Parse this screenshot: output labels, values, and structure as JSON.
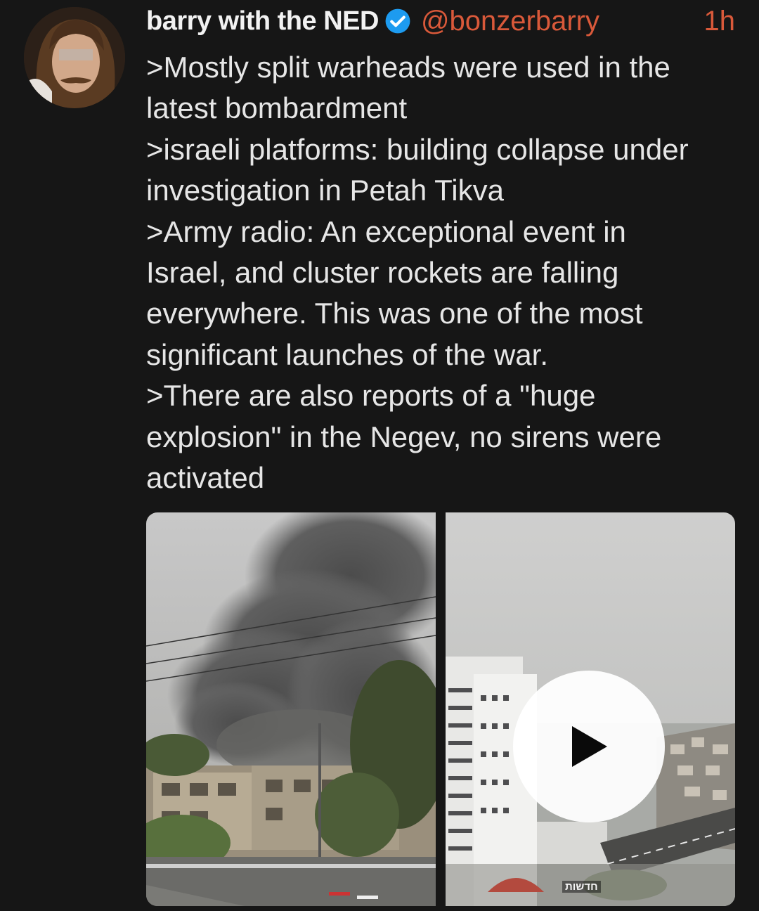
{
  "tweet": {
    "author_name": "barry with the NED",
    "handle": "@bonzerbarry",
    "time": "1h",
    "verified": true,
    "lines": [
      ">Mostly split warheads were used in the",
      "latest bombardment",
      ">israeli platforms: building collapse under",
      "investigation in Petah Tikva",
      ">Army radio: An exceptional event in",
      "Israel, and cluster rockets are falling",
      "everywhere. This was one of the most",
      "significant launches of the war.",
      ">There are also reports of a \"huge",
      "explosion\" in the Negev, no sirens were",
      "activated"
    ]
  },
  "media": {
    "left": {
      "kind": "photo",
      "icon": "smoke-photo"
    },
    "right": {
      "kind": "video",
      "icon": "play-icon",
      "watermark": "חדשות"
    }
  },
  "colors": {
    "background": "#161616",
    "accent": "#d9593a",
    "verified": "#1d9bf0",
    "text": "#e6e6e6"
  }
}
